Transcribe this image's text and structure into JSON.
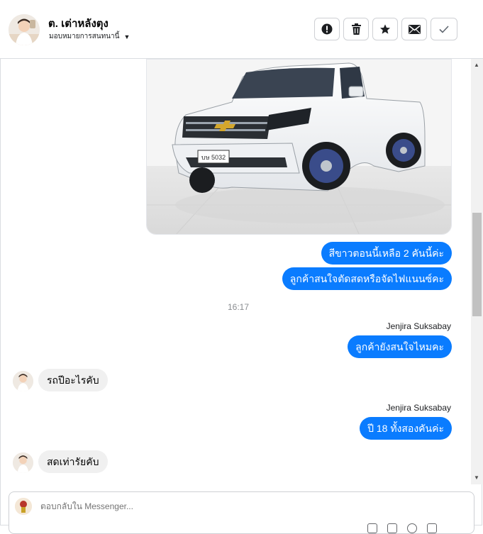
{
  "contact": {
    "name": "ต. เต่าหลังตุง",
    "assignment": "มอบหมายการสนทนานี้"
  },
  "toolbar": {
    "icons": [
      "alert-icon",
      "trash-icon",
      "star-icon",
      "mail-icon",
      "check-icon"
    ]
  },
  "messages": {
    "out_1": "สีขาวตอนนี้เหลือ 2 คันนี้ค่ะ",
    "out_2": "ลูกค้าสนใจตัดสดหรือจัดไฟแนนซ์คะ",
    "timestamp": "16:17",
    "sender_1": "Jenjira Suksabay",
    "out_3": "ลูกค้ายังสนใจไหมคะ",
    "in_1": "รถปีอะไรคับ",
    "sender_2": "Jenjira Suksabay",
    "out_4": "ปี 18 ทั้งสองคันค่ะ",
    "in_2": "สดเท่ารัยคับ"
  },
  "car": {
    "plate": "บษ 5032"
  },
  "composer": {
    "placeholder": "ตอบกลับใน Messenger..."
  },
  "colors": {
    "outgoing_bubble": "#0a7cff",
    "incoming_bubble": "#f0f0f0"
  }
}
